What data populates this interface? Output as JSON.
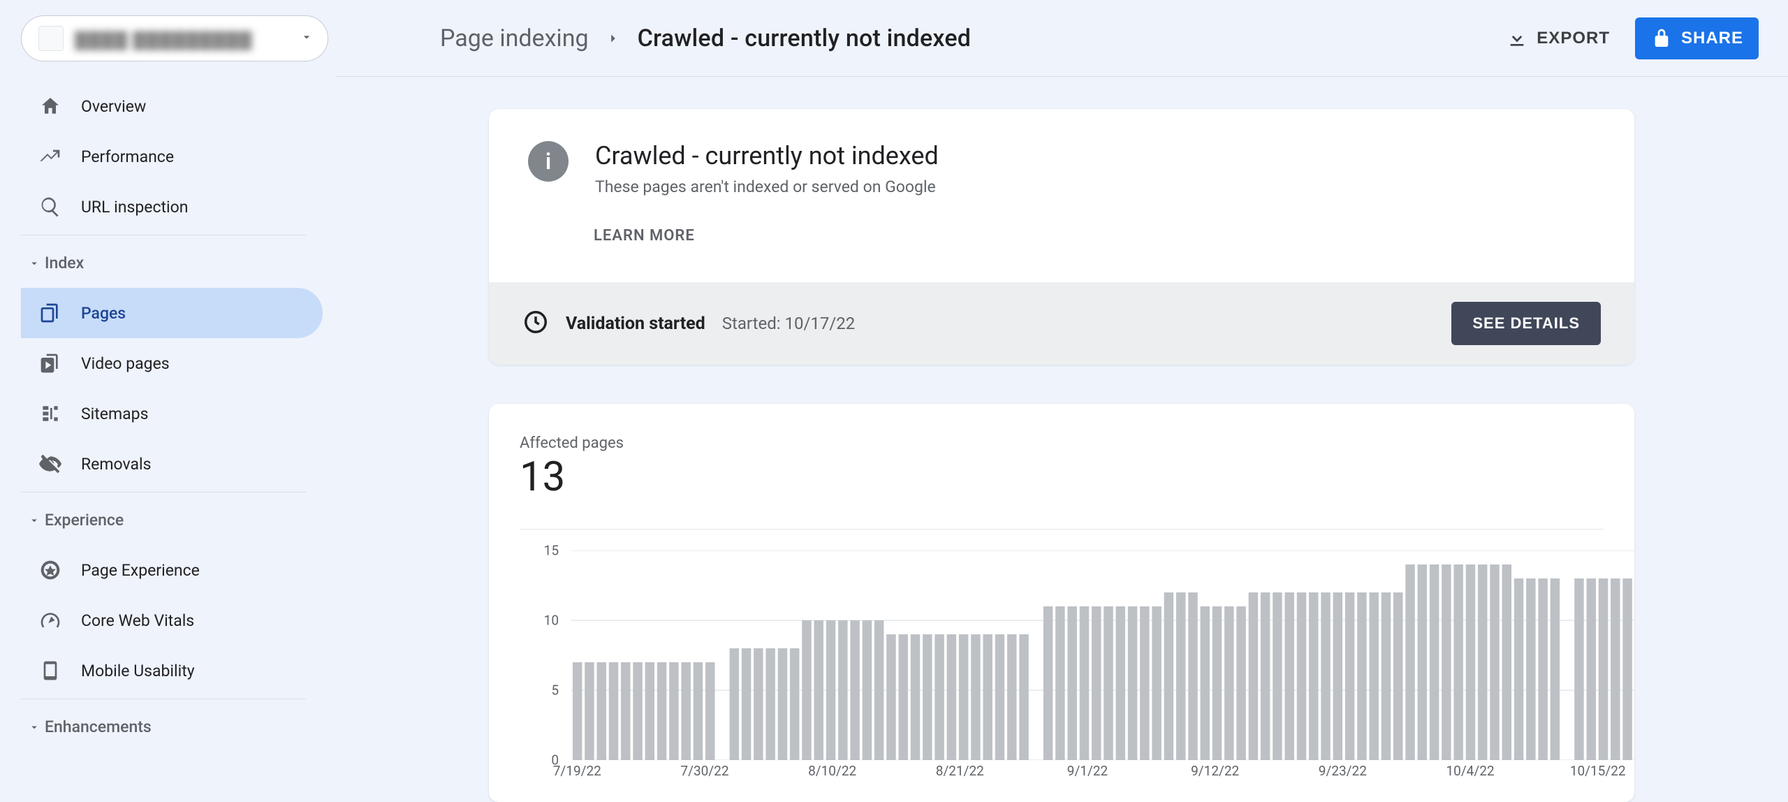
{
  "property_selector": {
    "display": "▓▓▓▓ ▓▓▓▓▓▓▓▓▓"
  },
  "nav": {
    "items": {
      "overview": "Overview",
      "performance": "Performance",
      "url_inspection": "URL inspection",
      "pages": "Pages",
      "video_pages": "Video pages",
      "sitemaps": "Sitemaps",
      "removals": "Removals",
      "page_experience": "Page Experience",
      "core_web_vitals": "Core Web Vitals",
      "mobile_usability": "Mobile Usability"
    },
    "groups": {
      "index": "Index",
      "experience": "Experience",
      "enhancements": "Enhancements"
    }
  },
  "topbar": {
    "crumb1": "Page indexing",
    "crumb2": "Crawled - currently not indexed",
    "export": "EXPORT",
    "share": "SHARE"
  },
  "info_card": {
    "title": "Crawled - currently not indexed",
    "subtitle": "These pages aren't indexed or served on Google",
    "learn_more": "LEARN MORE"
  },
  "validation": {
    "label": "Validation started",
    "date": "Started: 10/17/22",
    "see_details": "SEE DETAILS"
  },
  "chart_header": {
    "label": "Affected pages",
    "value": "13"
  },
  "chart_data": {
    "type": "bar",
    "title": "Affected pages",
    "ylabel": "",
    "xlabel": "",
    "ylim": [
      0,
      15
    ],
    "y_ticks": [
      0,
      5,
      10,
      15
    ],
    "x_tick_labels": [
      "7/19/22",
      "7/30/22",
      "8/10/22",
      "8/21/22",
      "9/1/22",
      "9/12/22",
      "9/23/22",
      "10/4/22",
      "10/15/22"
    ],
    "x_tick_positions": [
      0,
      11,
      22,
      33,
      44,
      55,
      66,
      77,
      88
    ],
    "categories_count": 89,
    "values": [
      7,
      7,
      7,
      7,
      7,
      7,
      7,
      7,
      7,
      7,
      7,
      7,
      0,
      8,
      8,
      8,
      8,
      8,
      8,
      10,
      10,
      10,
      10,
      10,
      10,
      10,
      9,
      9,
      9,
      9,
      9,
      9,
      9,
      9,
      9,
      9,
      9,
      9,
      0,
      11,
      11,
      11,
      11,
      11,
      11,
      11,
      11,
      11,
      11,
      12,
      12,
      12,
      11,
      11,
      11,
      11,
      12,
      12,
      12,
      12,
      12,
      12,
      12,
      12,
      12,
      12,
      12,
      12,
      12,
      14,
      14,
      14,
      14,
      14,
      14,
      14,
      14,
      14,
      13,
      13,
      13,
      13,
      0,
      13,
      13,
      13,
      13,
      13,
      13
    ]
  }
}
